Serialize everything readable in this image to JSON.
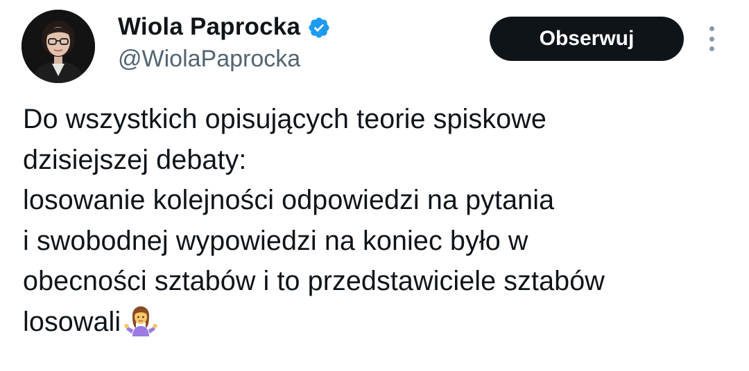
{
  "author": {
    "display_name": "Wiola Paprocka",
    "handle": "@WiolaPaprocka",
    "verified": true,
    "verified_icon": "verified-badge-icon",
    "verified_color": "#1d9bf0"
  },
  "actions": {
    "follow_label": "Obserwuj",
    "more_icon": "more-vertical-icon"
  },
  "tweet": {
    "text": "Do wszystkich opisujących teorie spiskowe\ndzisiejszej debaty:\nlosowanie kolejności odpowiedzi na pytania\ni swobodnej wypowiedzi na koniec było w\nobecności sztabów i to przedstawiciele sztabów\nlosowali",
    "emoji": "woman-shrugging-emoji"
  },
  "colors": {
    "text_primary": "#0f1419",
    "text_secondary": "#536471",
    "button_bg": "#0f1419",
    "button_text": "#ffffff",
    "background": "#ffffff"
  }
}
